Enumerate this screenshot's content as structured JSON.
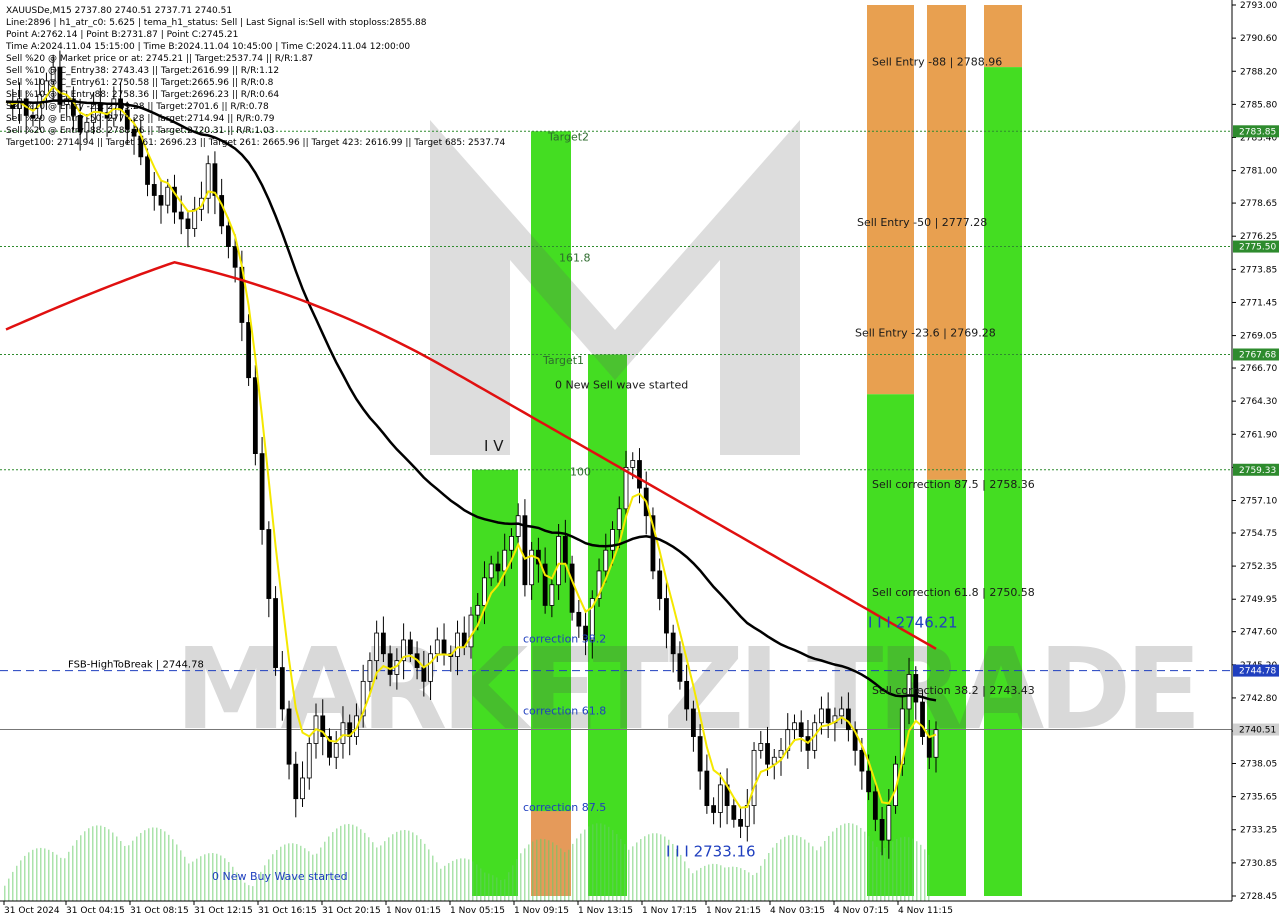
{
  "header": {
    "lines": [
      "XAUUSDe,M15  2737.80 2740.51 2737.71 2740.51",
      "Line:2896 | h1_atr_c0: 5.625 | tema_h1_status: Sell | Last Signal is:Sell with stoploss:2855.88",
      "Point A:2762.14 | Point B:2731.87 | Point C:2745.21",
      "Time A:2024.11.04 15:15:00 | Time B:2024.11.04 10:45:00 | Time C:2024.11.04 12:00:00",
      "Sell %20 @ Market price or at: 2745.21 || Target:2537.74 || R/R:1.87",
      "Sell %10 @ C_Entry38: 2743.43 || Target:2616.99 || R/R:1.12",
      "Sell %10 @ C_Entry61: 2750.58 || Target:2665.96 || R/R:0.8",
      "Sell %10 @ C_Entry88: 2758.36 || Target:2696.23 || R/R:0.64",
      "Sell %10 @ Entry -23: 2769.28 || Target:2701.6 || R/R:0.78",
      "Sell %20 @ Entry -50: 2777.28 || Target:2714.94 || R/R:0.79",
      "Sell %20 @ Entry -88: 2788.96 || Target:2720.31 || R/R:1.03",
      "Target100: 2714.94 || Target 161: 2696.23 || Target 261: 2665.96 || Target 423: 2616.99 || Target 685: 2537.74"
    ]
  },
  "chart_data": {
    "type": "candlestick",
    "symbol": "XAUUSDe",
    "timeframe": "M15",
    "ylim": [
      2728.45,
      2793.0
    ],
    "yticks": [
      2793.0,
      2790.6,
      2788.2,
      2785.8,
      2783.4,
      2781.0,
      2778.65,
      2776.25,
      2773.85,
      2771.45,
      2769.05,
      2766.7,
      2764.3,
      2761.9,
      2759.5,
      2757.1,
      2754.75,
      2752.35,
      2749.95,
      2747.6,
      2745.2,
      2742.8,
      2740.4,
      2738.05,
      2735.65,
      2733.25,
      2730.85,
      2728.45
    ],
    "ytick_labels": [
      "2793.00",
      "2790.60",
      "2788.20",
      "2785.80",
      "2783.40",
      "2781.00",
      "2778.65",
      "2776.25",
      "2773.85",
      "2771.45",
      "2769.05",
      "2766.70",
      "2764.30",
      "2761.90",
      "2759.50",
      "2757.10",
      "2754.75",
      "2752.35",
      "2749.95",
      "2747.60",
      "2745.20",
      "2742.80",
      "2740.40",
      "2738.05",
      "2735.65",
      "2733.25",
      "2730.85",
      "2728.45"
    ],
    "xtick_labels": [
      "31 Oct 2024",
      "31 Oct 04:15",
      "31 Oct 08:15",
      "31 Oct 12:15",
      "31 Oct 16:15",
      "31 Oct 20:15",
      "1 Nov 01:15",
      "1 Nov 05:15",
      "1 Nov 09:15",
      "1 Nov 13:15",
      "1 Nov 17:15",
      "1 Nov 21:15",
      "4 Nov 03:15",
      "4 Nov 07:15",
      "4 Nov 11:15"
    ],
    "current_price": 2740.51,
    "current_price_label": "2740.51",
    "horizontal_levels": [
      {
        "value": 2783.85,
        "label": "2783.85",
        "color": "#2e8b2e",
        "style": "dotted"
      },
      {
        "value": 2775.5,
        "label": "2775.50",
        "color": "#2e8b2e",
        "style": "dotted"
      },
      {
        "value": 2767.68,
        "label": "2767.68",
        "color": "#2e8b2e",
        "style": "dotted"
      },
      {
        "value": 2759.33,
        "label": "2759.33",
        "color": "#2e8b2e",
        "style": "dotted"
      },
      {
        "value": 2744.78,
        "label": "2744.78",
        "color": "#1f3fbf",
        "style": "dashed",
        "text": "FSB-HighToBreak | 2744.78"
      },
      {
        "value": 2740.51,
        "label": "2740.51",
        "color": "#777777",
        "style": "solid"
      }
    ],
    "zones": [
      {
        "name": "Target2",
        "from": 2728.45,
        "to": 2783.85,
        "color": "#44dd22"
      },
      {
        "name": "Target1",
        "from": 2728.45,
        "to": 2767.68,
        "color": "#44dd22"
      },
      {
        "name": "100",
        "from": 2728.45,
        "to": 2759.33,
        "color": "#44dd22"
      },
      {
        "name": "correction 87.5",
        "from": 2728.45,
        "to": 2734.6,
        "color": "#e59a5a"
      },
      {
        "name": "sell-zone-1-top",
        "from": 2764.8,
        "to": 2793.0,
        "color": "#e8a050"
      },
      {
        "name": "sell-zone-1-bottom",
        "from": 2728.45,
        "to": 2764.8,
        "color": "#44dd22"
      },
      {
        "name": "sell-zone-2-top",
        "from": 2758.6,
        "to": 2793.0,
        "color": "#e8a050"
      },
      {
        "name": "sell-zone-2-bottom",
        "from": 2728.45,
        "to": 2758.6,
        "color": "#44dd22"
      },
      {
        "name": "sell-zone-3-top",
        "from": 2788.5,
        "to": 2793.0,
        "color": "#e8a050"
      },
      {
        "name": "sell-zone-3-bottom",
        "from": 2728.45,
        "to": 2788.5,
        "color": "#44dd22"
      }
    ],
    "annotations": [
      {
        "text": "Target2",
        "price": 2783.2
      },
      {
        "text": "161.8",
        "price": 2774.4
      },
      {
        "text": "Target1",
        "price": 2767.0
      },
      {
        "text": "0 New Sell wave started",
        "price": 2765.2
      },
      {
        "text": "I V",
        "price": 2760.7
      },
      {
        "text": "100",
        "price": 2758.9
      },
      {
        "text": "correction 38.2",
        "price": 2746.8
      },
      {
        "text": "correction 61.8",
        "price": 2741.6
      },
      {
        "text": "correction 87.5",
        "price": 2734.6
      },
      {
        "text": "I I I 2733.16",
        "price": 2731.3
      },
      {
        "text": "0 New Buy Wave started",
        "price": 2729.6
      },
      {
        "text": "Sell Entry -88 | 2788.96",
        "price": 2788.6
      },
      {
        "text": "Sell Entry -50 | 2777.28",
        "price": 2777.0
      },
      {
        "text": "Sell Entry -23.6 | 2769.28",
        "price": 2769.0
      },
      {
        "text": "Sell correction 87.5 | 2758.36",
        "price": 2758.0
      },
      {
        "text": "Sell correction 61.8 | 2750.58",
        "price": 2750.2
      },
      {
        "text": "I I I 2746.21",
        "price": 2747.9
      },
      {
        "text": "Sell correction 38.2 | 2743.43",
        "price": 2743.1
      }
    ],
    "price_path": [
      2786.0,
      2785.5,
      2786.2,
      2785.0,
      2784.8,
      2786.5,
      2787.5,
      2788.5,
      2785.8,
      2786.2,
      2785.0,
      2783.8,
      2784.5,
      2785.8,
      2785.2,
      2784.8,
      2786.2,
      2785.4,
      2784.0,
      2783.5,
      2782.0,
      2780.0,
      2779.2,
      2778.5,
      2779.8,
      2778.0,
      2777.5,
      2776.8,
      2778.2,
      2779.0,
      2781.5,
      2779.2,
      2777.0,
      2775.5,
      2774.0,
      2770.0,
      2766.0,
      2760.5,
      2755.0,
      2750.0,
      2745.0,
      2742.0,
      2738.0,
      2735.5,
      2737.0,
      2739.5,
      2741.5,
      2740.0,
      2738.5,
      2739.5,
      2741.0,
      2740.0,
      2741.5,
      2744.0,
      2745.5,
      2747.5,
      2746.0,
      2744.5,
      2745.5,
      2747.0,
      2746.0,
      2745.0,
      2744.0,
      2746.0,
      2747.0,
      2746.0,
      2745.8,
      2747.5,
      2746.5,
      2748.8,
      2749.5,
      2751.5,
      2752.5,
      2752.0,
      2753.5,
      2754.5,
      2756.0,
      2751.0,
      2753.5,
      2752.5,
      2749.5,
      2751.0,
      2754.5,
      2752.5,
      2749.0,
      2748.0,
      2747.0,
      2750.0,
      2752.0,
      2753.5,
      2755.0,
      2756.5,
      2759.5,
      2760.0,
      2758.0,
      2756.0,
      2752.0,
      2750.0,
      2747.5,
      2746.0,
      2744.0,
      2742.0,
      2740.0,
      2737.5,
      2735.0,
      2734.5,
      2736.5,
      2735.0,
      2734.0,
      2733.5,
      2735.0,
      2739.0,
      2739.5,
      2738.0,
      2738.5,
      2739.0,
      2740.5,
      2741.0,
      2740.0,
      2739.0,
      2741.0,
      2742.0,
      2741.0,
      2741.5,
      2742.0,
      2740.5,
      2739.0,
      2737.5,
      2736.0,
      2734.0,
      2732.5,
      2735.0,
      2738.0,
      2742.0,
      2744.5,
      2742.5,
      2740.0,
      2738.5,
      2740.5
    ]
  },
  "watermark": "MARKETZI TRADE"
}
